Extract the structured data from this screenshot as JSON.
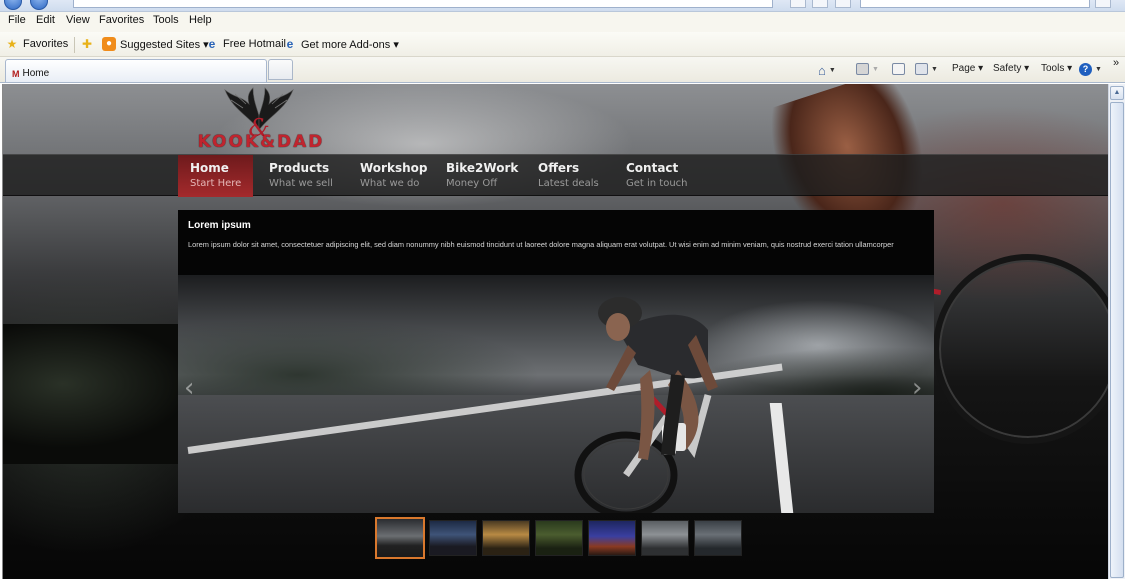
{
  "browser": {
    "menu": [
      "File",
      "Edit",
      "View",
      "Favorites",
      "Tools",
      "Help"
    ],
    "favorites": {
      "favorites_label": "Favorites",
      "items": [
        "Suggested Sites ▾",
        "Free Hotmail",
        "Get more Add-ons ▾"
      ]
    },
    "tab": {
      "title": "Home",
      "favicon": "M"
    },
    "commands": [
      "Page ▾",
      "Safety ▾",
      "Tools ▾"
    ],
    "overflow": "»"
  },
  "site": {
    "logo_text": "KOOK&DAD",
    "nav": [
      {
        "title": "Home",
        "subtitle": "Start Here",
        "active": true
      },
      {
        "title": "Products",
        "subtitle": "What we sell",
        "active": false
      },
      {
        "title": "Workshop",
        "subtitle": "What we do",
        "active": false
      },
      {
        "title": "Bike2Work",
        "subtitle": "Money Off",
        "active": false
      },
      {
        "title": "Offers",
        "subtitle": "Latest deals",
        "active": false
      },
      {
        "title": "Contact",
        "subtitle": "Get in touch",
        "active": false
      }
    ],
    "caption": {
      "title": "Lorem ipsum",
      "text": "Lorem ipsum dolor sit amet, consectetuer adipiscing elit, sed diam nonummy nibh euismod tincidunt ut laoreet dolore magna aliquam erat volutpat. Ut wisi enim ad minim veniam, quis nostrud exerci tation ullamcorper"
    },
    "slider": {
      "prev": "‹",
      "next": "›",
      "active_index": 0,
      "thumb_count": 7
    },
    "colors": {
      "accent_red": "#c0242e",
      "active_thumb_border": "#d9782d",
      "nav_active": "#a42a2c"
    }
  }
}
